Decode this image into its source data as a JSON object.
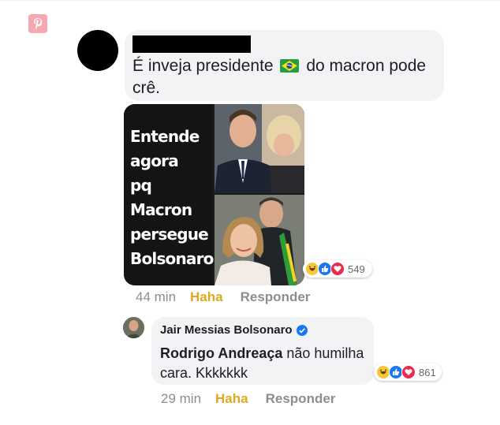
{
  "comment1": {
    "text_before_flag": "É inveja presidente",
    "text_after_flag": "do macron pode crê.",
    "meta": {
      "time": "44 min",
      "haha": "Haha",
      "reply": "Responder"
    },
    "reactions_count": "549"
  },
  "meme": {
    "lines": [
      "Entende",
      "agora",
      "pq Macron",
      "persegue",
      "Bolsonaro?"
    ]
  },
  "comment2": {
    "author": "Jair Messias Bolsonaro",
    "mention": "Rodrigo Andreaça",
    "text": " não humilha cara. Kkkkkkk",
    "meta": {
      "time": "29 min",
      "haha": "Haha",
      "reply": "Responder"
    },
    "reactions_count": "861"
  },
  "colors": {
    "bubble": "#f2f3f5",
    "haha": "#e0a820",
    "meta": "#8a8d91",
    "like": "#1877f2",
    "love": "#f0284a"
  }
}
